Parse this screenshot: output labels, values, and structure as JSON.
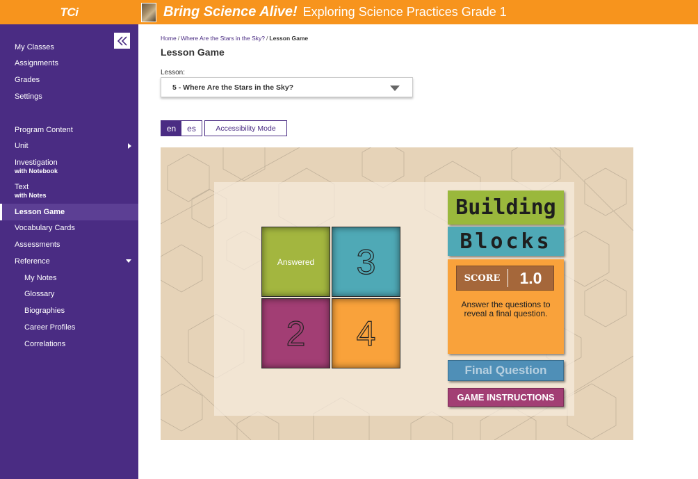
{
  "header": {
    "brand": "TCi",
    "program_brand": "Bring Science Alive!",
    "program_title": "Exploring Science Practices Grade 1"
  },
  "sidebar": {
    "collapse_icon": "double-chevron-left-icon",
    "items": [
      {
        "label": "My Classes"
      },
      {
        "label": "Assignments"
      },
      {
        "label": "Grades"
      },
      {
        "label": "Settings"
      },
      {
        "label": "Program Content"
      },
      {
        "label": "Unit"
      },
      {
        "label": "Investigation",
        "sub": "with Notebook"
      },
      {
        "label": "Text",
        "sub": "with Notes"
      },
      {
        "label": "Lesson Game"
      },
      {
        "label": "Vocabulary Cards"
      },
      {
        "label": "Assessments"
      },
      {
        "label": "Reference"
      },
      {
        "label": "My Notes"
      },
      {
        "label": "Glossary"
      },
      {
        "label": "Biographies"
      },
      {
        "label": "Career Profiles"
      },
      {
        "label": "Correlations"
      }
    ]
  },
  "breadcrumb": {
    "home": "Home",
    "sep": "/",
    "lesson": "Where Are the Stars in the Sky?",
    "current": "Lesson Game"
  },
  "page": {
    "title": "Lesson Game",
    "lesson_label": "Lesson:",
    "lesson_selected": "5 - Where Are the Stars in the Sky?"
  },
  "controls": {
    "lang_en": "en",
    "lang_es": "es",
    "accessibility": "Accessibility Mode"
  },
  "game": {
    "title_line1": "Building",
    "title_line2": "Blocks",
    "tiles": {
      "answered": "Answered",
      "t3": "3",
      "t2": "2",
      "t4": "4"
    },
    "score_label": "SCORE",
    "score_value": "1.0",
    "message": "Answer the questions to reveal a final question.",
    "final_question": "Final Question",
    "instructions": "GAME INSTRUCTIONS",
    "colors": {
      "green": "#a3b63f",
      "teal": "#4fa9b6",
      "magenta": "#a23e74",
      "orange": "#f9a23b"
    }
  }
}
